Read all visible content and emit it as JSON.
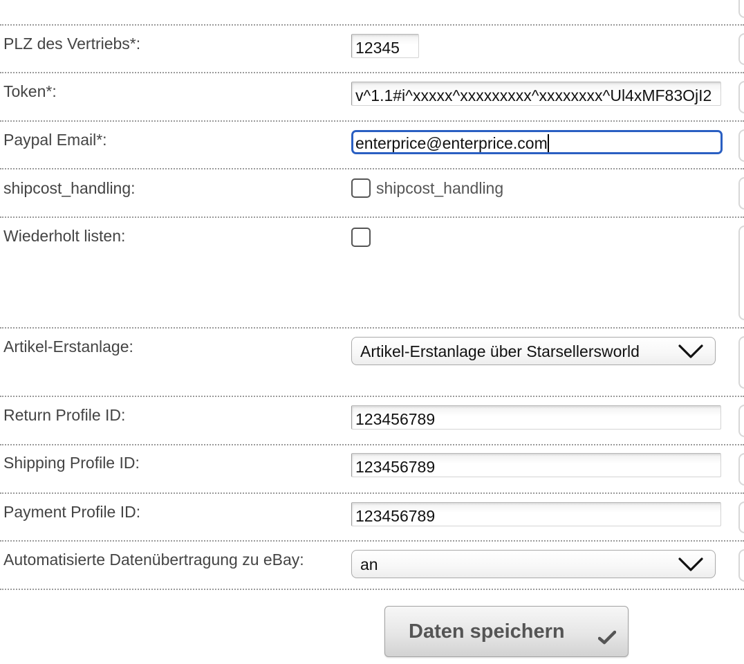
{
  "form": {
    "fields": [
      {
        "label": "PLZ des Vertriebs*:",
        "value": "12345"
      },
      {
        "label": "Token*:",
        "value": "v^1.1#i^xxxxx^xxxxxxxxx^xxxxxxxx^Ul4xMF83OjI2"
      },
      {
        "label": "Paypal Email*:",
        "value": "enterprice@enterprice.com"
      },
      {
        "label": "shipcost_handling:",
        "checkbox_label": "shipcost_handling",
        "checked": false
      },
      {
        "label": "Wiederholt listen:",
        "checked": false
      },
      {
        "label": "Artikel-Erstanlage:",
        "selected": "Artikel-Erstanlage über Starsellersworld"
      },
      {
        "label": "Return Profile ID:",
        "value": "123456789"
      },
      {
        "label": "Shipping Profile ID:",
        "value": "123456789"
      },
      {
        "label": "Payment Profile ID:",
        "value": "123456789"
      },
      {
        "label": "Automatisierte Datenübertragung zu eBay:",
        "selected": "an"
      }
    ],
    "submit_label": "Daten speichern"
  },
  "icons": {
    "dropdown": "chevron-down-icon",
    "submit": "checkmark-icon"
  },
  "colors": {
    "focus_ring": "#2a5fc2",
    "label_text": "#444444",
    "separator": "#9a9a9a"
  }
}
